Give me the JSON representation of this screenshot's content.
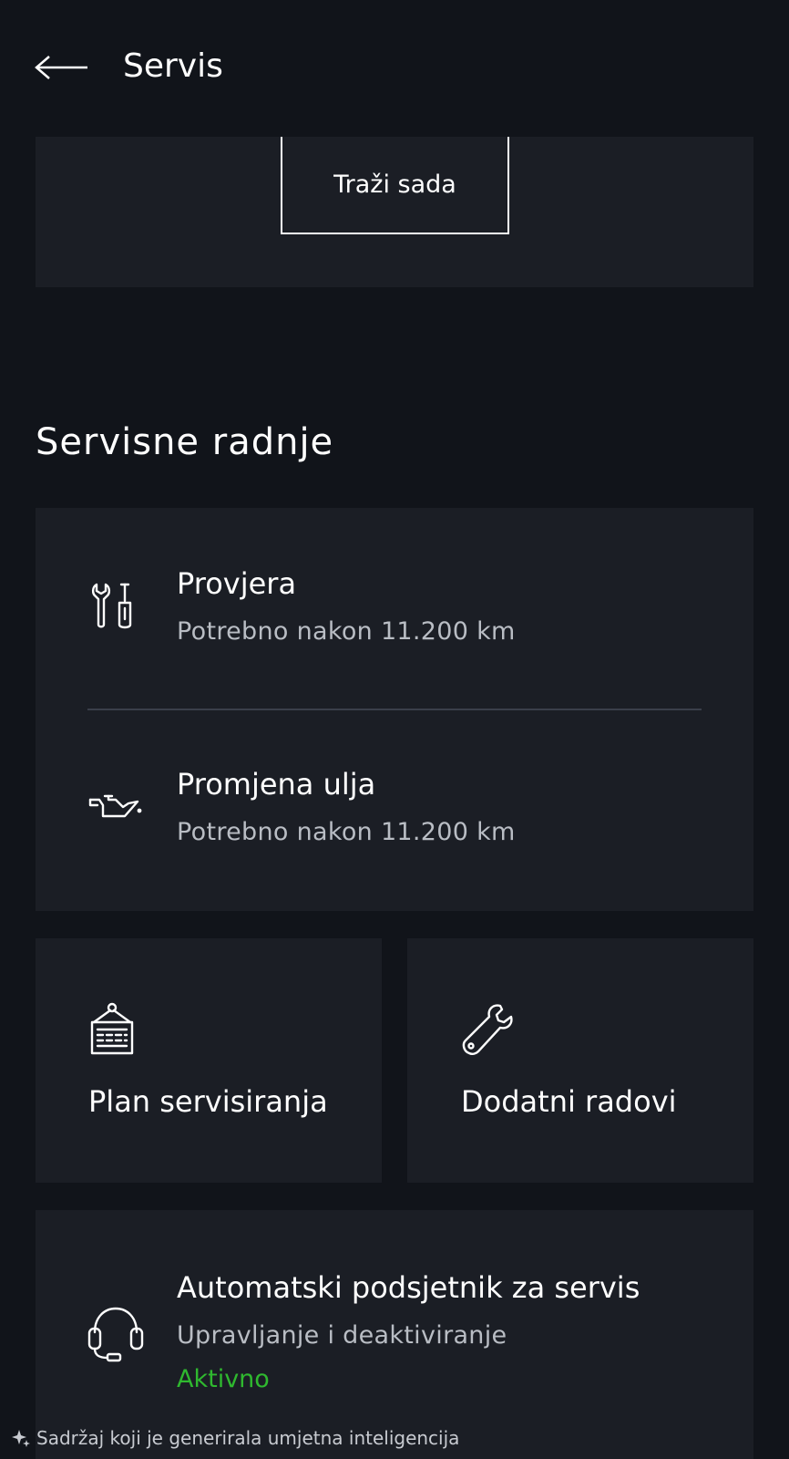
{
  "header": {
    "back_icon": "arrow-left-icon",
    "title": "Servis"
  },
  "top_card": {
    "search_button_label": "Traži sada"
  },
  "section": {
    "title": "Servisne radnje"
  },
  "service_actions": [
    {
      "icon": "tools-icon",
      "title": "Provjera",
      "subtitle": "Potrebno nakon 11.200 km"
    },
    {
      "icon": "oil-can-icon",
      "title": "Promjena ulja",
      "subtitle": "Potrebno nakon 11.200 km"
    }
  ],
  "tiles": [
    {
      "icon": "schedule-board-icon",
      "label": "Plan servisiranja"
    },
    {
      "icon": "wrench-icon",
      "label": "Dodatni radovi"
    }
  ],
  "reminder": {
    "icon": "headset-icon",
    "title": "Automatski podsjetnik za servis",
    "subtitle": "Upravljanje i deaktiviranje",
    "status": "Aktivno",
    "status_color": "#2fb82f"
  },
  "footer": {
    "icon": "ai-sparkle-icon",
    "text": "Sadržaj koji je generirala umjetna inteligencija"
  },
  "colors": {
    "background": "#11141a",
    "card": "#1b1e25",
    "text_primary": "#ffffff",
    "text_secondary": "#b9bdc4"
  }
}
